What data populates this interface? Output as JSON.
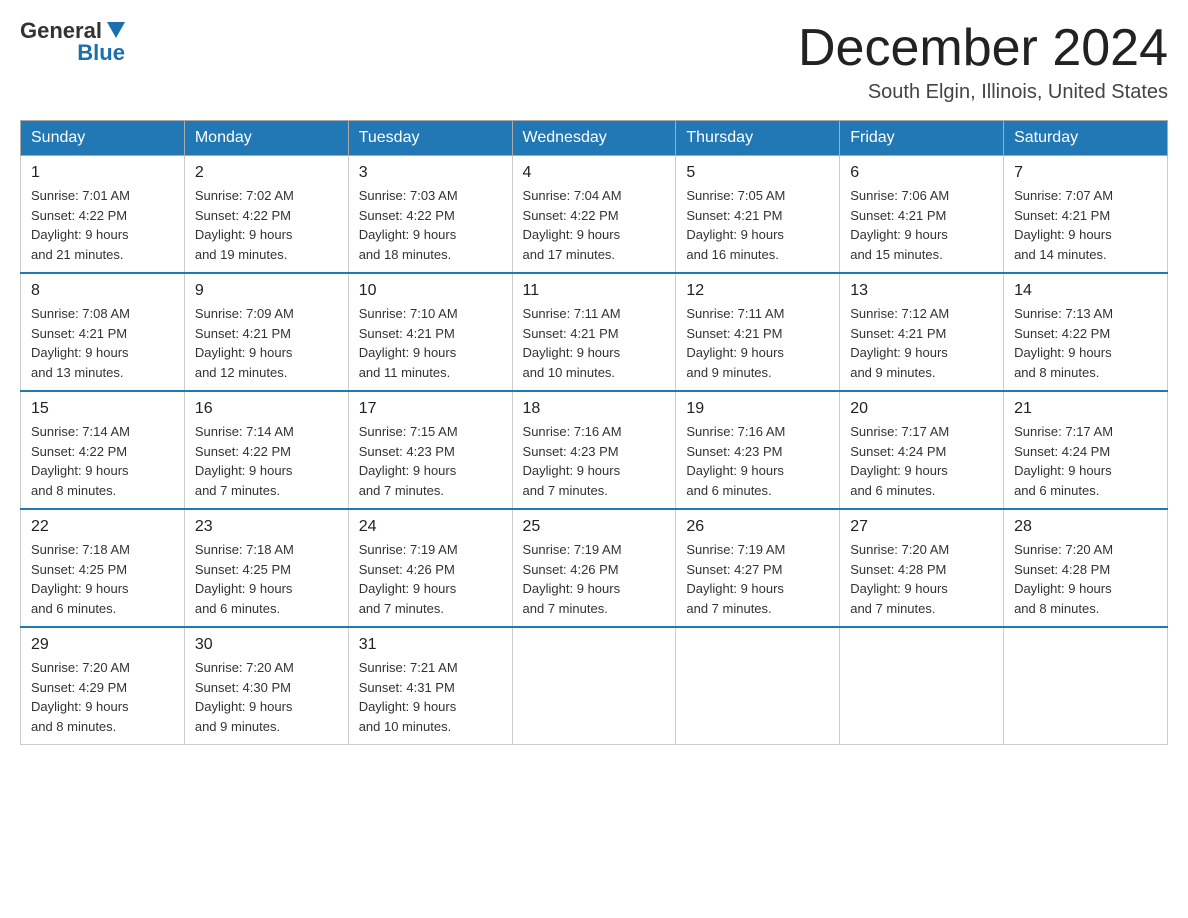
{
  "header": {
    "logo_general": "General",
    "logo_blue": "Blue",
    "month_title": "December 2024",
    "location": "South Elgin, Illinois, United States"
  },
  "days_of_week": [
    "Sunday",
    "Monday",
    "Tuesday",
    "Wednesday",
    "Thursday",
    "Friday",
    "Saturday"
  ],
  "weeks": [
    [
      {
        "day": "1",
        "sunrise": "7:01 AM",
        "sunset": "4:22 PM",
        "daylight": "9 hours and 21 minutes."
      },
      {
        "day": "2",
        "sunrise": "7:02 AM",
        "sunset": "4:22 PM",
        "daylight": "9 hours and 19 minutes."
      },
      {
        "day": "3",
        "sunrise": "7:03 AM",
        "sunset": "4:22 PM",
        "daylight": "9 hours and 18 minutes."
      },
      {
        "day": "4",
        "sunrise": "7:04 AM",
        "sunset": "4:22 PM",
        "daylight": "9 hours and 17 minutes."
      },
      {
        "day": "5",
        "sunrise": "7:05 AM",
        "sunset": "4:21 PM",
        "daylight": "9 hours and 16 minutes."
      },
      {
        "day": "6",
        "sunrise": "7:06 AM",
        "sunset": "4:21 PM",
        "daylight": "9 hours and 15 minutes."
      },
      {
        "day": "7",
        "sunrise": "7:07 AM",
        "sunset": "4:21 PM",
        "daylight": "9 hours and 14 minutes."
      }
    ],
    [
      {
        "day": "8",
        "sunrise": "7:08 AM",
        "sunset": "4:21 PM",
        "daylight": "9 hours and 13 minutes."
      },
      {
        "day": "9",
        "sunrise": "7:09 AM",
        "sunset": "4:21 PM",
        "daylight": "9 hours and 12 minutes."
      },
      {
        "day": "10",
        "sunrise": "7:10 AM",
        "sunset": "4:21 PM",
        "daylight": "9 hours and 11 minutes."
      },
      {
        "day": "11",
        "sunrise": "7:11 AM",
        "sunset": "4:21 PM",
        "daylight": "9 hours and 10 minutes."
      },
      {
        "day": "12",
        "sunrise": "7:11 AM",
        "sunset": "4:21 PM",
        "daylight": "9 hours and 9 minutes."
      },
      {
        "day": "13",
        "sunrise": "7:12 AM",
        "sunset": "4:21 PM",
        "daylight": "9 hours and 9 minutes."
      },
      {
        "day": "14",
        "sunrise": "7:13 AM",
        "sunset": "4:22 PM",
        "daylight": "9 hours and 8 minutes."
      }
    ],
    [
      {
        "day": "15",
        "sunrise": "7:14 AM",
        "sunset": "4:22 PM",
        "daylight": "9 hours and 8 minutes."
      },
      {
        "day": "16",
        "sunrise": "7:14 AM",
        "sunset": "4:22 PM",
        "daylight": "9 hours and 7 minutes."
      },
      {
        "day": "17",
        "sunrise": "7:15 AM",
        "sunset": "4:23 PM",
        "daylight": "9 hours and 7 minutes."
      },
      {
        "day": "18",
        "sunrise": "7:16 AM",
        "sunset": "4:23 PM",
        "daylight": "9 hours and 7 minutes."
      },
      {
        "day": "19",
        "sunrise": "7:16 AM",
        "sunset": "4:23 PM",
        "daylight": "9 hours and 6 minutes."
      },
      {
        "day": "20",
        "sunrise": "7:17 AM",
        "sunset": "4:24 PM",
        "daylight": "9 hours and 6 minutes."
      },
      {
        "day": "21",
        "sunrise": "7:17 AM",
        "sunset": "4:24 PM",
        "daylight": "9 hours and 6 minutes."
      }
    ],
    [
      {
        "day": "22",
        "sunrise": "7:18 AM",
        "sunset": "4:25 PM",
        "daylight": "9 hours and 6 minutes."
      },
      {
        "day": "23",
        "sunrise": "7:18 AM",
        "sunset": "4:25 PM",
        "daylight": "9 hours and 6 minutes."
      },
      {
        "day": "24",
        "sunrise": "7:19 AM",
        "sunset": "4:26 PM",
        "daylight": "9 hours and 7 minutes."
      },
      {
        "day": "25",
        "sunrise": "7:19 AM",
        "sunset": "4:26 PM",
        "daylight": "9 hours and 7 minutes."
      },
      {
        "day": "26",
        "sunrise": "7:19 AM",
        "sunset": "4:27 PM",
        "daylight": "9 hours and 7 minutes."
      },
      {
        "day": "27",
        "sunrise": "7:20 AM",
        "sunset": "4:28 PM",
        "daylight": "9 hours and 7 minutes."
      },
      {
        "day": "28",
        "sunrise": "7:20 AM",
        "sunset": "4:28 PM",
        "daylight": "9 hours and 8 minutes."
      }
    ],
    [
      {
        "day": "29",
        "sunrise": "7:20 AM",
        "sunset": "4:29 PM",
        "daylight": "9 hours and 8 minutes."
      },
      {
        "day": "30",
        "sunrise": "7:20 AM",
        "sunset": "4:30 PM",
        "daylight": "9 hours and 9 minutes."
      },
      {
        "day": "31",
        "sunrise": "7:21 AM",
        "sunset": "4:31 PM",
        "daylight": "9 hours and 10 minutes."
      },
      null,
      null,
      null,
      null
    ]
  ]
}
